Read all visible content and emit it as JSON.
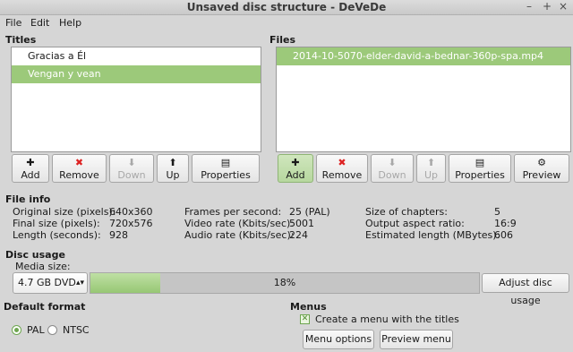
{
  "window": {
    "title": "Unsaved disc structure - DeVeDe",
    "minimize": "–",
    "maximize": "+",
    "close": "×"
  },
  "menu": [
    "File",
    "Edit",
    "Help"
  ],
  "titles": {
    "heading": "Titles",
    "items": [
      {
        "label": "Gracias a Él",
        "selected": false
      },
      {
        "label": "Vengan y vean",
        "selected": true
      }
    ],
    "buttons": {
      "add": "Add",
      "remove": "Remove",
      "down": "Down",
      "up": "Up",
      "properties": "Properties"
    }
  },
  "files": {
    "heading": "Files",
    "items": [
      {
        "label": "2014-10-5070-elder-david-a-bednar-360p-spa.mp4",
        "selected": true
      }
    ],
    "buttons": {
      "add": "Add",
      "remove": "Remove",
      "down": "Down",
      "up": "Up",
      "properties": "Properties",
      "preview": "Preview"
    }
  },
  "icons": {
    "add": "✚",
    "remove": "✖",
    "down": "⬇",
    "up": "⬆",
    "properties": "▤",
    "preview": "⚙"
  },
  "file_info": {
    "heading": "File info",
    "original_size_label": "Original size (pixels):",
    "original_size_value": "640x360",
    "final_size_label": "Final size (pixels):",
    "final_size_value": "720x576",
    "length_label": "Length (seconds):",
    "length_value": "928",
    "fps_label": "Frames per second:",
    "fps_value": "25 (PAL)",
    "video_rate_label": "Video rate (Kbits/sec):",
    "video_rate_value": "5001",
    "audio_rate_label": "Audio rate (Kbits/sec):",
    "audio_rate_value": "224",
    "chapters_label": "Size of chapters:",
    "chapters_value": "5",
    "aspect_label": "Output aspect ratio:",
    "aspect_value": "16:9",
    "est_length_label": "Estimated length (MBytes):",
    "est_length_value": "606"
  },
  "disc_usage": {
    "heading": "Disc usage",
    "media_label": "Media size:",
    "media_value": "4.7 GB DVD",
    "spin": "▴▾",
    "usage_percent": 18,
    "usage_text": "18%",
    "adjust_button": "Adjust disc usage"
  },
  "default_format": {
    "heading": "Default format",
    "options": [
      {
        "label": "PAL",
        "selected": true
      },
      {
        "label": "NTSC",
        "selected": false
      }
    ]
  },
  "menus": {
    "heading": "Menus",
    "create_menu_label": "Create a menu with the titles",
    "create_menu_checked": true,
    "check_mark": "✕",
    "menu_options_button": "Menu options",
    "preview_menu_button": "Preview menu"
  },
  "colors": {
    "selection": "#9cc97a",
    "progress_fill": "#97c774"
  }
}
